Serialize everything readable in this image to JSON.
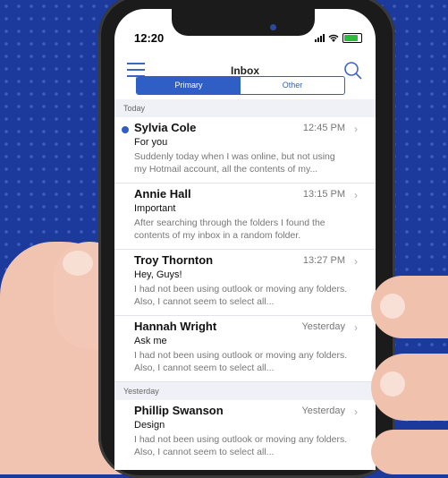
{
  "status": {
    "time": "12:20"
  },
  "header": {
    "title": "Inbox"
  },
  "tabs": [
    {
      "label": "Primary",
      "active": true
    },
    {
      "label": "Other",
      "active": false
    }
  ],
  "sections": [
    {
      "label": "Today"
    },
    {
      "label": "Yesterday"
    }
  ],
  "emails": [
    {
      "sender": "Sylvia Cole",
      "time": "12:45 PM",
      "subject": "For you",
      "preview": "Suddenly today when I was online, but not using my Hotmail account, all the contents of my...",
      "unread": true
    },
    {
      "sender": "Annie Hall",
      "time": "13:15 PM",
      "subject": "Important",
      "preview": "After searching through the folders I found the contents of my inbox in a random folder.",
      "unread": false
    },
    {
      "sender": "Troy Thornton",
      "time": "13:27 PM",
      "subject": "Hey, Guys!",
      "preview": "I had not been using outlook or moving any folders. Also, I cannot seem to select all...",
      "unread": false
    },
    {
      "sender": "Hannah Wright",
      "time": "Yesterday",
      "subject": "Ask me",
      "preview": "I had not been using outlook or moving any folders. Also, I cannot seem to select all...",
      "unread": false
    },
    {
      "sender": "Phillip Swanson",
      "time": "Yesterday",
      "subject": "Design",
      "preview": "I had not been using outlook or moving any folders. Also, I cannot seem to select all...",
      "unread": false
    }
  ],
  "colors": {
    "accent": "#2f5fc4",
    "background": "#1c3a9c",
    "battery": "#2bbd3a"
  },
  "icons": [
    "menu-icon",
    "search-icon",
    "chevron-right-icon",
    "signal-icon",
    "wifi-icon",
    "battery-icon"
  ]
}
